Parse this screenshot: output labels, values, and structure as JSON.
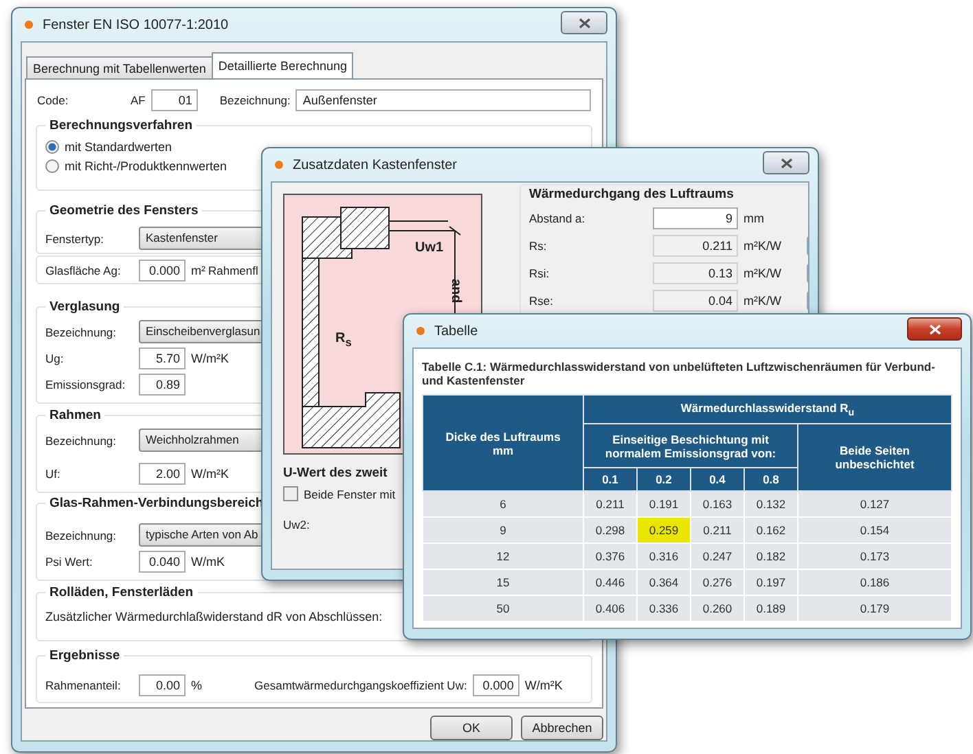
{
  "main_window": {
    "title": "Fenster EN ISO 10077-1:2010",
    "active": false,
    "tabs": [
      {
        "label": "Berechnung mit Tabellenwerten",
        "selected": false
      },
      {
        "label": "Detaillierte Berechnung",
        "selected": true
      }
    ],
    "sections": [
      {
        "kind": "row",
        "rows": [
          {
            "items": [
              {
                "kind": "label",
                "text": "Code:"
              },
              {
                "kind": "label",
                "text": "AF"
              },
              {
                "kind": "field",
                "text": "01"
              },
              {
                "kind": "label",
                "text": "Bezeichnung:"
              },
              {
                "kind": "text_field",
                "text": "Außenfenster"
              }
            ]
          }
        ]
      },
      {
        "kind": "group",
        "title": "Berechnungsverfahren",
        "rows": [
          {
            "items": [
              {
                "kind": "radio",
                "text": "mit Standardwerten",
                "selected": true
              }
            ]
          },
          {
            "items": [
              {
                "kind": "radio",
                "text": "mit Richt-/Produktkennwerten",
                "selected": false
              }
            ]
          }
        ]
      },
      {
        "kind": "group",
        "title": "Geometrie des Fensters",
        "rows": [
          {
            "items": [
              {
                "kind": "label",
                "text": "Fenstertyp:"
              },
              {
                "kind": "dropdown",
                "text": "Kastenfenster"
              }
            ]
          }
        ]
      },
      {
        "kind": "group",
        "rows": [
          {
            "items": [
              {
                "kind": "label",
                "text": "Glasfläche Ag:"
              },
              {
                "kind": "field",
                "text": "0.000"
              },
              {
                "kind": "unit",
                "text": "m²"
              },
              {
                "kind": "label",
                "text": "Rahmenfl"
              }
            ]
          }
        ]
      },
      {
        "kind": "group",
        "title": "Verglasung",
        "rows": [
          {
            "items": [
              {
                "kind": "label",
                "text": "Bezeichnung:"
              },
              {
                "kind": "dropdown",
                "text": "Einscheibenverglasun"
              }
            ]
          },
          {
            "items": [
              {
                "kind": "label",
                "text": "Ug:"
              },
              {
                "kind": "field",
                "text": "5.70"
              },
              {
                "kind": "unit",
                "text": "W/m²K"
              }
            ]
          },
          {
            "items": [
              {
                "kind": "label",
                "text": "Emissionsgrad:"
              },
              {
                "kind": "field",
                "text": "0.89"
              }
            ]
          }
        ]
      },
      {
        "kind": "group",
        "title": "Rahmen",
        "rows": [
          {
            "items": [
              {
                "kind": "label",
                "text": "Bezeichnung:"
              },
              {
                "kind": "dropdown",
                "text": "Weichholzrahmen"
              }
            ]
          },
          {
            "items": [
              {
                "kind": "label",
                "text": "Uf:"
              },
              {
                "kind": "field",
                "text": "2.00"
              },
              {
                "kind": "unit",
                "text": "W/m²K"
              }
            ]
          }
        ]
      },
      {
        "kind": "group",
        "title": "Glas-Rahmen-Verbindungsbereich",
        "rows": [
          {
            "items": [
              {
                "kind": "label",
                "text": "Bezeichnung:"
              },
              {
                "kind": "dropdown",
                "text": "typische Arten von Ab"
              }
            ]
          },
          {
            "items": [
              {
                "kind": "label",
                "text": "Psi Wert:"
              },
              {
                "kind": "field",
                "text": "0.040"
              },
              {
                "kind": "unit",
                "text": "W/mK"
              }
            ]
          }
        ]
      },
      {
        "kind": "group",
        "title": "Rolläden, Fensterläden",
        "rows": [
          {
            "items": [
              {
                "kind": "note",
                "text": "Zusätzlicher Wärmedurchlaßwiderstand dR von Abschlüssen:"
              }
            ]
          }
        ]
      },
      {
        "kind": "group",
        "title": "Ergebnisse",
        "rows": [
          {
            "items": [
              {
                "kind": "label",
                "text": "Rahmenanteil:"
              },
              {
                "kind": "field",
                "text": "0.00"
              },
              {
                "kind": "unit",
                "text": "%"
              },
              {
                "kind": "label",
                "text": "Gesamtwärmedurchgangskoeffizient Uw:"
              },
              {
                "kind": "field",
                "text": "0.000"
              },
              {
                "kind": "unit",
                "text": "W/m²K"
              }
            ]
          }
        ]
      }
    ],
    "buttons": [
      "OK",
      "Abbrechen"
    ]
  },
  "detail_window": {
    "title": "Zusatzdaten Kastenfenster",
    "active": false,
    "diagram_labels": [
      {
        "kind": "uw",
        "text": "Uw1"
      },
      {
        "kind": "rs",
        "text": "R$_{s}$"
      },
      {
        "kind": "dimension",
        "text": "and"
      }
    ],
    "air_gap": {
      "title": "Wärmedurchgang des Luftraums",
      "rows": [
        {
          "label": "Abstand a:",
          "value": "9",
          "unit": "mm",
          "editable": true,
          "lookup": false
        },
        {
          "label": "Rs:",
          "value": "0.211",
          "unit": "m²K/W",
          "editable": false,
          "lookup": true
        },
        {
          "label": "Rsi:",
          "value": "0.13",
          "unit": "m²K/W",
          "editable": false,
          "lookup": true
        },
        {
          "label": "Rse:",
          "value": "0.04",
          "unit": "m²K/W",
          "editable": false,
          "lookup": true
        }
      ]
    },
    "second_window": {
      "title": "U-Wert des zweit",
      "checkbox": {
        "label": "Beide Fenster mit",
        "checked": false
      },
      "uw2_label": "Uw2:"
    }
  },
  "table_window": {
    "title": "Tabelle",
    "active": true,
    "caption": "Tabelle C.1: Wärmedurchlasswiderstand von unbelüfteten Luftzwischenräumen für Verbund- und Kastenfenster",
    "header": {
      "thickness_label": "Dicke des Luftraums",
      "thickness_unit": "mm",
      "resistance": "Wärmedurchlasswiderstand R$_{u}$",
      "one_side": "Einseitige Beschichtung mit normalem Emissionsgrad von:",
      "emissivities": [
        "0.1",
        "0.2",
        "0.4",
        "0.8"
      ],
      "both_sides": "Beide Seiten unbeschichtet"
    },
    "rows": [
      {
        "thickness": "6",
        "values": [
          {
            "text": "0.211",
            "selected": false
          },
          {
            "text": "0.191",
            "selected": false
          },
          {
            "text": "0.163",
            "selected": false
          },
          {
            "text": "0.132",
            "selected": false
          }
        ],
        "uncoated": "0.127"
      },
      {
        "thickness": "9",
        "values": [
          {
            "text": "0.298",
            "selected": false
          },
          {
            "text": "0.259",
            "selected": true
          },
          {
            "text": "0.211",
            "selected": false
          },
          {
            "text": "0.162",
            "selected": false
          }
        ],
        "uncoated": "0.154"
      },
      {
        "thickness": "12",
        "values": [
          {
            "text": "0.376",
            "selected": false
          },
          {
            "text": "0.316",
            "selected": false
          },
          {
            "text": "0.247",
            "selected": false
          },
          {
            "text": "0.182",
            "selected": false
          }
        ],
        "uncoated": "0.173"
      },
      {
        "thickness": "15",
        "values": [
          {
            "text": "0.446",
            "selected": false
          },
          {
            "text": "0.364",
            "selected": false
          },
          {
            "text": "0.276",
            "selected": false
          },
          {
            "text": "0.197",
            "selected": false
          }
        ],
        "uncoated": "0.186"
      },
      {
        "thickness": "50",
        "values": [
          {
            "text": "0.406",
            "selected": false
          },
          {
            "text": "0.336",
            "selected": false
          },
          {
            "text": "0.260",
            "selected": false
          },
          {
            "text": "0.189",
            "selected": false
          }
        ],
        "uncoated": "0.179"
      }
    ]
  }
}
